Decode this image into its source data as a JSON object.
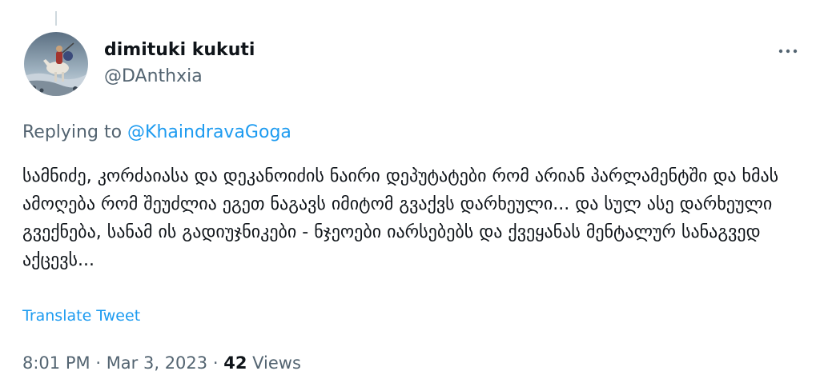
{
  "tweet": {
    "author": {
      "name": "dimituki kukuti",
      "handle": "@DAnthxia"
    },
    "replying_to": {
      "prefix": "Replying to",
      "handle": "@KhaindravaGoga"
    },
    "text": "სამნიძე, კორძაიასა და დეკანოიძის ნაირი დეპუტატები რომ არიან პარლამენტში და ხმას ამოღება რომ შეუძლია ეგეთ ნაგავს იმიტომ გვაქვს დარხეული... და სულ ასე დარხეული გვექნება, სანამ ის გადიუჯნიკები - ნჯეოები იარსებებს და ქვეყანას მენტალურ სანაგვედ აქცევს...",
    "translate_label": "Translate Tweet",
    "time": "8:01 PM",
    "date": "Mar 3, 2023",
    "separator": "·",
    "views_count": "42",
    "views_label": "Views"
  },
  "icons": {
    "more": "more-horizontal-icon"
  },
  "colors": {
    "text_primary": "#0f1419",
    "text_secondary": "#536471",
    "link": "#1d9bf0",
    "divider": "#cfd9de"
  }
}
